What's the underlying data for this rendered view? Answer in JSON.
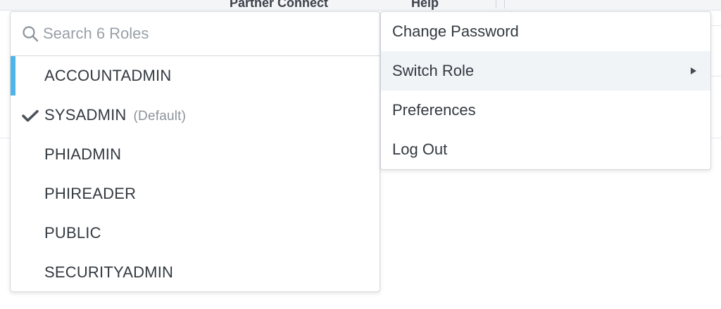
{
  "background": {
    "topbar_items": [
      "Partner Connect",
      "Help"
    ]
  },
  "role_switcher": {
    "search": {
      "placeholder": "Search 6 Roles",
      "value": ""
    },
    "roles": [
      {
        "label": "ACCOUNTADMIN",
        "focused": true,
        "selected": false,
        "tag": ""
      },
      {
        "label": "SYSADMIN",
        "focused": false,
        "selected": true,
        "tag": "(Default)"
      },
      {
        "label": "PHIADMIN",
        "focused": false,
        "selected": false,
        "tag": ""
      },
      {
        "label": "PHIREADER",
        "focused": false,
        "selected": false,
        "tag": ""
      },
      {
        "label": "PUBLIC",
        "focused": false,
        "selected": false,
        "tag": ""
      },
      {
        "label": "SECURITYADMIN",
        "focused": false,
        "selected": false,
        "tag": ""
      }
    ]
  },
  "user_menu": {
    "items": [
      {
        "label": "Change Password",
        "has_submenu": false,
        "highlighted": false
      },
      {
        "label": "Switch Role",
        "has_submenu": true,
        "highlighted": true
      },
      {
        "label": "Preferences",
        "has_submenu": false,
        "highlighted": false
      },
      {
        "label": "Log Out",
        "has_submenu": false,
        "highlighted": false
      }
    ]
  },
  "colors": {
    "accent": "#4fb5e8",
    "text": "#333940",
    "muted": "#8c939b",
    "highlight_bg": "#f0f4f7"
  },
  "icons": {
    "search": "search-icon",
    "selected": "checkmark-icon",
    "submenu": "caret-right-icon"
  }
}
